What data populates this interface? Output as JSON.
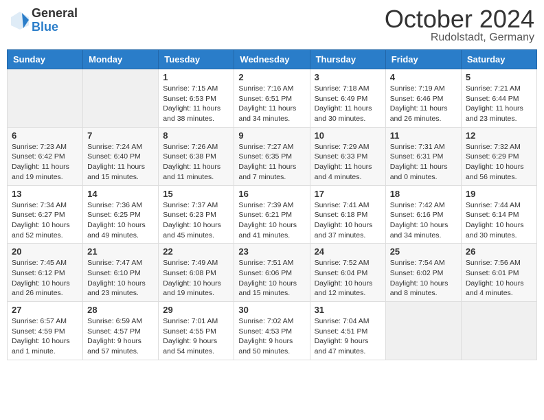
{
  "header": {
    "logo_general": "General",
    "logo_blue": "Blue",
    "month_title": "October 2024",
    "location": "Rudolstadt, Germany"
  },
  "days_of_week": [
    "Sunday",
    "Monday",
    "Tuesday",
    "Wednesday",
    "Thursday",
    "Friday",
    "Saturday"
  ],
  "weeks": [
    [
      {
        "day": "",
        "info": ""
      },
      {
        "day": "",
        "info": ""
      },
      {
        "day": "1",
        "info": "Sunrise: 7:15 AM\nSunset: 6:53 PM\nDaylight: 11 hours and 38 minutes."
      },
      {
        "day": "2",
        "info": "Sunrise: 7:16 AM\nSunset: 6:51 PM\nDaylight: 11 hours and 34 minutes."
      },
      {
        "day": "3",
        "info": "Sunrise: 7:18 AM\nSunset: 6:49 PM\nDaylight: 11 hours and 30 minutes."
      },
      {
        "day": "4",
        "info": "Sunrise: 7:19 AM\nSunset: 6:46 PM\nDaylight: 11 hours and 26 minutes."
      },
      {
        "day": "5",
        "info": "Sunrise: 7:21 AM\nSunset: 6:44 PM\nDaylight: 11 hours and 23 minutes."
      }
    ],
    [
      {
        "day": "6",
        "info": "Sunrise: 7:23 AM\nSunset: 6:42 PM\nDaylight: 11 hours and 19 minutes."
      },
      {
        "day": "7",
        "info": "Sunrise: 7:24 AM\nSunset: 6:40 PM\nDaylight: 11 hours and 15 minutes."
      },
      {
        "day": "8",
        "info": "Sunrise: 7:26 AM\nSunset: 6:38 PM\nDaylight: 11 hours and 11 minutes."
      },
      {
        "day": "9",
        "info": "Sunrise: 7:27 AM\nSunset: 6:35 PM\nDaylight: 11 hours and 7 minutes."
      },
      {
        "day": "10",
        "info": "Sunrise: 7:29 AM\nSunset: 6:33 PM\nDaylight: 11 hours and 4 minutes."
      },
      {
        "day": "11",
        "info": "Sunrise: 7:31 AM\nSunset: 6:31 PM\nDaylight: 11 hours and 0 minutes."
      },
      {
        "day": "12",
        "info": "Sunrise: 7:32 AM\nSunset: 6:29 PM\nDaylight: 10 hours and 56 minutes."
      }
    ],
    [
      {
        "day": "13",
        "info": "Sunrise: 7:34 AM\nSunset: 6:27 PM\nDaylight: 10 hours and 52 minutes."
      },
      {
        "day": "14",
        "info": "Sunrise: 7:36 AM\nSunset: 6:25 PM\nDaylight: 10 hours and 49 minutes."
      },
      {
        "day": "15",
        "info": "Sunrise: 7:37 AM\nSunset: 6:23 PM\nDaylight: 10 hours and 45 minutes."
      },
      {
        "day": "16",
        "info": "Sunrise: 7:39 AM\nSunset: 6:21 PM\nDaylight: 10 hours and 41 minutes."
      },
      {
        "day": "17",
        "info": "Sunrise: 7:41 AM\nSunset: 6:18 PM\nDaylight: 10 hours and 37 minutes."
      },
      {
        "day": "18",
        "info": "Sunrise: 7:42 AM\nSunset: 6:16 PM\nDaylight: 10 hours and 34 minutes."
      },
      {
        "day": "19",
        "info": "Sunrise: 7:44 AM\nSunset: 6:14 PM\nDaylight: 10 hours and 30 minutes."
      }
    ],
    [
      {
        "day": "20",
        "info": "Sunrise: 7:45 AM\nSunset: 6:12 PM\nDaylight: 10 hours and 26 minutes."
      },
      {
        "day": "21",
        "info": "Sunrise: 7:47 AM\nSunset: 6:10 PM\nDaylight: 10 hours and 23 minutes."
      },
      {
        "day": "22",
        "info": "Sunrise: 7:49 AM\nSunset: 6:08 PM\nDaylight: 10 hours and 19 minutes."
      },
      {
        "day": "23",
        "info": "Sunrise: 7:51 AM\nSunset: 6:06 PM\nDaylight: 10 hours and 15 minutes."
      },
      {
        "day": "24",
        "info": "Sunrise: 7:52 AM\nSunset: 6:04 PM\nDaylight: 10 hours and 12 minutes."
      },
      {
        "day": "25",
        "info": "Sunrise: 7:54 AM\nSunset: 6:02 PM\nDaylight: 10 hours and 8 minutes."
      },
      {
        "day": "26",
        "info": "Sunrise: 7:56 AM\nSunset: 6:01 PM\nDaylight: 10 hours and 4 minutes."
      }
    ],
    [
      {
        "day": "27",
        "info": "Sunrise: 6:57 AM\nSunset: 4:59 PM\nDaylight: 10 hours and 1 minute."
      },
      {
        "day": "28",
        "info": "Sunrise: 6:59 AM\nSunset: 4:57 PM\nDaylight: 9 hours and 57 minutes."
      },
      {
        "day": "29",
        "info": "Sunrise: 7:01 AM\nSunset: 4:55 PM\nDaylight: 9 hours and 54 minutes."
      },
      {
        "day": "30",
        "info": "Sunrise: 7:02 AM\nSunset: 4:53 PM\nDaylight: 9 hours and 50 minutes."
      },
      {
        "day": "31",
        "info": "Sunrise: 7:04 AM\nSunset: 4:51 PM\nDaylight: 9 hours and 47 minutes."
      },
      {
        "day": "",
        "info": ""
      },
      {
        "day": "",
        "info": ""
      }
    ]
  ]
}
